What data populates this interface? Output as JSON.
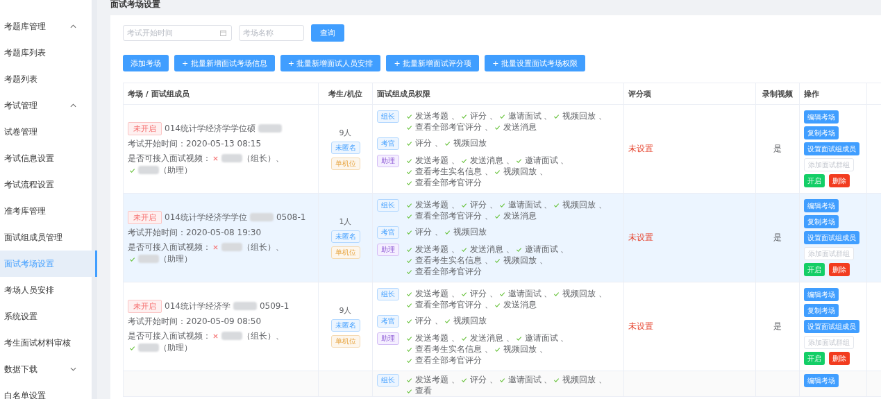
{
  "sidebar": {
    "items": [
      {
        "label": "考题库管理",
        "expanded": true,
        "selected": false,
        "children": [
          {
            "label": "考题库列表",
            "selected": false
          },
          {
            "label": "考题列表",
            "selected": false
          }
        ]
      },
      {
        "label": "考试管理",
        "expanded": true,
        "selected": false,
        "children": [
          {
            "label": "试卷管理",
            "selected": false
          },
          {
            "label": "考试信息设置",
            "selected": false
          },
          {
            "label": "考试流程设置",
            "selected": false
          },
          {
            "label": "准考库管理",
            "selected": false
          },
          {
            "label": "面试组成员管理",
            "selected": false
          },
          {
            "label": "面试考场设置",
            "selected": true
          },
          {
            "label": "考场人员安排",
            "selected": false
          },
          {
            "label": "系统设置",
            "selected": false
          },
          {
            "label": "考生面试材料审核",
            "selected": false
          }
        ]
      },
      {
        "label": "数据下载",
        "expanded": false,
        "selected": false
      },
      {
        "label": "白名单设置",
        "selected": false
      }
    ]
  },
  "page_title": "面试考场设置",
  "filters": {
    "date_placeholder": "考试开始时间",
    "name_placeholder": "考场名称",
    "search_button": "查询"
  },
  "toolbar": [
    "添加考场",
    "+ 批量新增面试考场信息",
    "+ 批量新增面试人员安排",
    "+ 批量新增面试评分项",
    "+ 批量设置面试考场权限"
  ],
  "table": {
    "columns": [
      "考场 / 面试组成员",
      "考生/机位",
      "面试组成员权限",
      "评分项",
      "录制视频",
      "操作"
    ],
    "rows": [
      {
        "highlighted": false,
        "status": "未开启",
        "name": "014统计学经济学学位硕",
        "suffix": "",
        "start": "考试开始时间：2020-05-13 08:15",
        "video_label": "是否可接入面试视频：",
        "members": [
          {
            "video_ok": false,
            "role": "（组长）、"
          },
          {
            "video_ok": true,
            "role": "（助理）"
          }
        ],
        "count": "9人",
        "tags": [
          {
            "label": "未匿名",
            "kind": "info"
          },
          {
            "label": "单机位",
            "kind": "warn"
          }
        ],
        "roles": [
          {
            "label": "组长",
            "kind": "leader",
            "perms": [
              "发送考题 、",
              "评分 、",
              "邀请面试 、",
              "视频回放 、",
              "查看全部考官评分 、",
              "发送消息"
            ]
          },
          {
            "label": "考官",
            "kind": "examiner",
            "perms": [
              "评分 、",
              "视频回放"
            ]
          },
          {
            "label": "助理",
            "kind": "assistant",
            "perms": [
              "发送考题 、",
              "发送消息 、",
              "邀请面试 、",
              "查看考生实名信息 、",
              "视频回放 、",
              "查看全部考官评分"
            ]
          }
        ],
        "score": "未设置",
        "record": "是",
        "actions": [
          {
            "label": "编辑考场",
            "kind": "primary"
          },
          {
            "label": "复制考场",
            "kind": "primary"
          },
          {
            "label": "设置面试组成员",
            "kind": "primary"
          },
          {
            "label": "添加面试群组",
            "kind": "disabled"
          },
          {
            "label": "开启",
            "kind": "success"
          },
          {
            "label": "删除",
            "kind": "danger"
          }
        ]
      },
      {
        "highlighted": true,
        "status": "未开启",
        "name": "014统计学经济学学位",
        "suffix": "0508-1",
        "start": "考试开始时间：2020-05-08 19:30",
        "video_label": "是否可接入面试视频：",
        "members": [
          {
            "video_ok": false,
            "role": "（组长）、"
          },
          {
            "video_ok": true,
            "role": "（助理）"
          }
        ],
        "count": "1人",
        "tags": [
          {
            "label": "未匿名",
            "kind": "info"
          },
          {
            "label": "单机位",
            "kind": "warn"
          }
        ],
        "roles": [
          {
            "label": "组长",
            "kind": "leader",
            "perms": [
              "发送考题 、",
              "评分 、",
              "邀请面试 、",
              "视频回放 、",
              "查看全部考官评分 、",
              "发送消息"
            ]
          },
          {
            "label": "考官",
            "kind": "examiner",
            "perms": [
              "评分 、",
              "视频回放"
            ]
          },
          {
            "label": "助理",
            "kind": "assistant",
            "perms": [
              "发送考题 、",
              "发送消息 、",
              "邀请面试 、",
              "查看考生实名信息 、",
              "视频回放 、",
              "查看全部考官评分"
            ]
          }
        ],
        "score": "未设置",
        "record": "是",
        "actions": [
          {
            "label": "编辑考场",
            "kind": "primary"
          },
          {
            "label": "复制考场",
            "kind": "primary"
          },
          {
            "label": "设置面试组成员",
            "kind": "primary"
          },
          {
            "label": "添加面试群组",
            "kind": "disabled"
          },
          {
            "label": "开启",
            "kind": "success"
          },
          {
            "label": "删除",
            "kind": "danger"
          }
        ]
      },
      {
        "highlighted": false,
        "status": "未开启",
        "name": "014统计学经济学",
        "suffix": "0509-1",
        "start": "考试开始时间：2020-05-09 08:50",
        "video_label": "是否可接入面试视频：",
        "members": [
          {
            "video_ok": false,
            "role": "（组长）、"
          },
          {
            "video_ok": true,
            "role": "（助理）"
          }
        ],
        "count": "9人",
        "tags": [
          {
            "label": "未匿名",
            "kind": "info"
          },
          {
            "label": "单机位",
            "kind": "warn"
          }
        ],
        "roles": [
          {
            "label": "组长",
            "kind": "leader",
            "perms": [
              "发送考题 、",
              "评分 、",
              "邀请面试 、",
              "视频回放 、",
              "查看全部考官评分 、",
              "发送消息"
            ]
          },
          {
            "label": "考官",
            "kind": "examiner",
            "perms": [
              "评分 、",
              "视频回放"
            ]
          },
          {
            "label": "助理",
            "kind": "assistant",
            "perms": [
              "发送考题 、",
              "发送消息 、",
              "邀请面试 、",
              "查看考生实名信息 、",
              "视频回放 、",
              "查看全部考官评分"
            ]
          }
        ],
        "score": "未设置",
        "record": "是",
        "actions": [
          {
            "label": "编辑考场",
            "kind": "primary"
          },
          {
            "label": "复制考场",
            "kind": "primary"
          },
          {
            "label": "设置面试组成员",
            "kind": "primary"
          },
          {
            "label": "添加面试群组",
            "kind": "disabled"
          },
          {
            "label": "开启",
            "kind": "success"
          },
          {
            "label": "删除",
            "kind": "danger"
          }
        ]
      },
      {
        "highlighted": false,
        "roles": [
          {
            "label": "组长",
            "kind": "leader",
            "perms": [
              "发送考题 、",
              "评分 、",
              "邀请面试 、",
              "视频回放 、",
              "查看"
            ]
          }
        ],
        "actions": [
          {
            "label": "编辑考场",
            "kind": "primary"
          }
        ]
      }
    ]
  }
}
